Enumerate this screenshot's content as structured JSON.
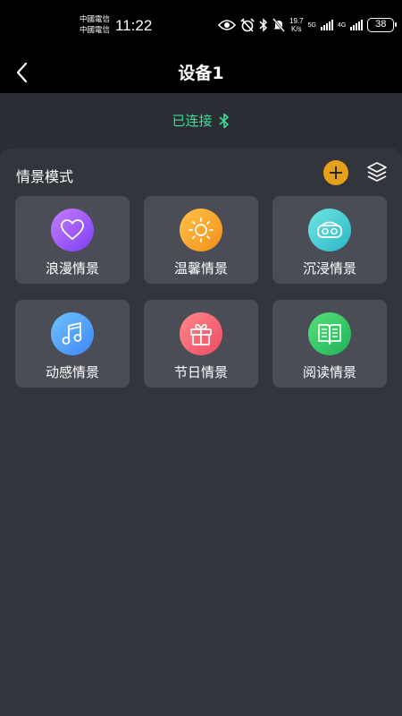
{
  "status_bar": {
    "carrier1": "中國電信",
    "carrier2": "中國電信",
    "time": "11:22",
    "speed_value": "19.7",
    "speed_unit": "K/s",
    "net1": "5G",
    "net2": "4G",
    "battery": "38"
  },
  "header": {
    "title": "设备1"
  },
  "connection": {
    "status": "已连接",
    "icon": "bluetooth-icon",
    "color": "#3ddc97"
  },
  "scene_panel": {
    "title": "情景模式",
    "add_icon": "plus-icon",
    "layers_icon": "layers-icon",
    "scenes": [
      {
        "label": "浪漫情景",
        "icon": "heart-icon",
        "color_from": "#c77dff",
        "color_to": "#7b3ff2"
      },
      {
        "label": "温馨情景",
        "icon": "sun-icon",
        "color_from": "#ffc247",
        "color_to": "#f28f1a"
      },
      {
        "label": "沉浸情景",
        "icon": "vr-goggles-icon",
        "color_from": "#6fe6e0",
        "color_to": "#2bb6c7"
      },
      {
        "label": "动感情景",
        "icon": "music-note-icon",
        "color_from": "#6fc3ff",
        "color_to": "#3e86f5"
      },
      {
        "label": "节日情景",
        "icon": "gift-icon",
        "color_from": "#ff8a8a",
        "color_to": "#ef4964"
      },
      {
        "label": "阅读情景",
        "icon": "book-icon",
        "color_from": "#57e07a",
        "color_to": "#1fb257"
      }
    ]
  }
}
